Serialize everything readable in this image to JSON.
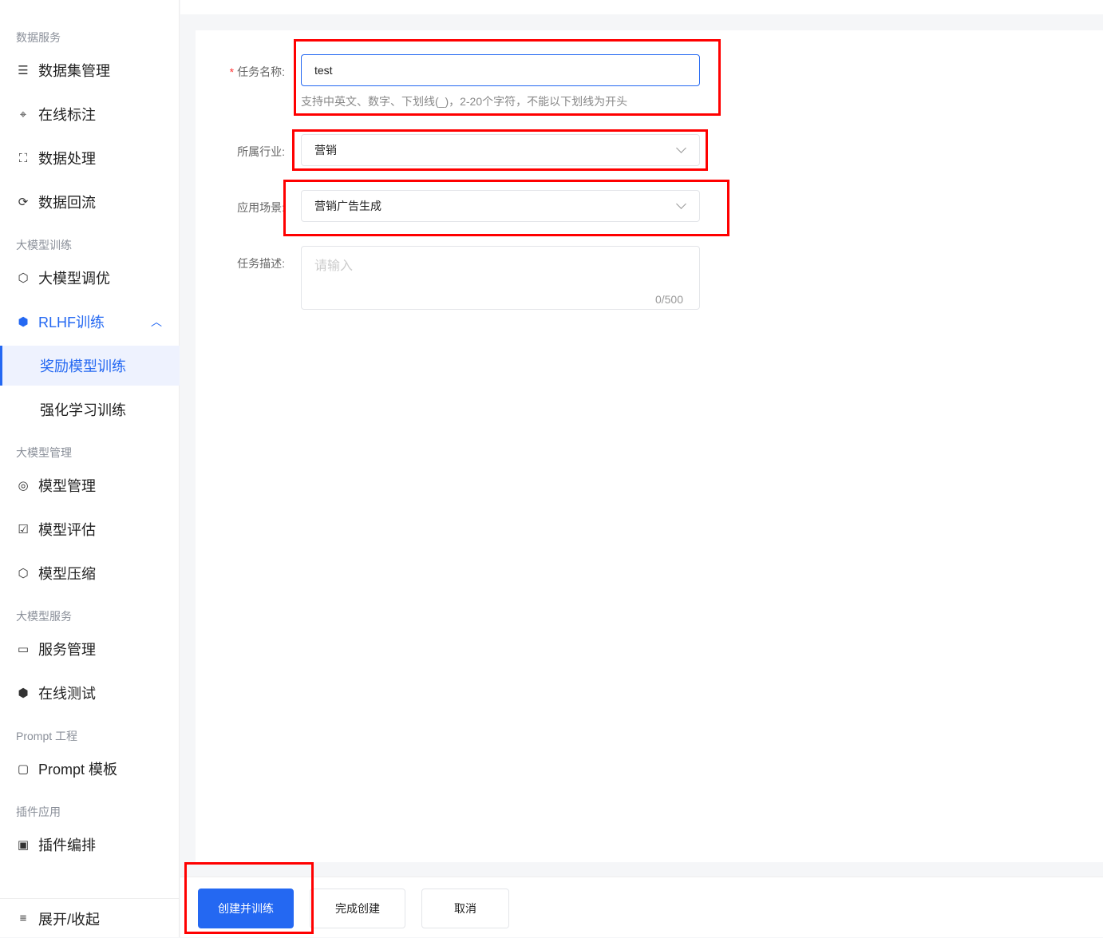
{
  "sidebar": {
    "groups": [
      "数据服务",
      "大模型训练",
      "大模型管理",
      "大模型服务",
      "Prompt 工程",
      "插件应用"
    ],
    "items": [
      {
        "label": "数据集管理",
        "icon": "database-icon"
      },
      {
        "label": "在线标注",
        "icon": "scan-icon"
      },
      {
        "label": "数据处理",
        "icon": "process-icon"
      },
      {
        "label": "数据回流",
        "icon": "refresh-icon"
      },
      {
        "label": "大模型调优",
        "icon": "model-tune-icon"
      },
      {
        "label": "RLHF训练",
        "icon": "cube-icon"
      },
      {
        "label": "奖励模型训练"
      },
      {
        "label": "强化学习训练"
      },
      {
        "label": "模型管理",
        "icon": "model-icon"
      },
      {
        "label": "模型评估",
        "icon": "evaluate-icon"
      },
      {
        "label": "模型压缩",
        "icon": "compress-icon"
      },
      {
        "label": "服务管理",
        "icon": "service-icon"
      },
      {
        "label": "在线测试",
        "icon": "test-icon"
      },
      {
        "label": "Prompt 模板",
        "icon": "template-icon"
      },
      {
        "label": "插件编排",
        "icon": "plugin-icon"
      }
    ],
    "collapse_label": "展开/收起"
  },
  "form": {
    "name_label": "任务名称:",
    "required_mark": "*",
    "name_value": "test",
    "name_hint": "支持中英文、数字、下划线(_)，2-20个字符，不能以下划线为开头",
    "industry_label": "所属行业:",
    "industry_value": "营销",
    "scene_label": "应用场景:",
    "scene_value": "营销广告生成",
    "desc_label": "任务描述:",
    "desc_placeholder": "请输入",
    "desc_count": "0/500"
  },
  "footer": {
    "create_train": "创建并训练",
    "finish": "完成创建",
    "cancel": "取消"
  },
  "colors": {
    "accent": "#2468f2",
    "annotation": "#ff0000"
  }
}
